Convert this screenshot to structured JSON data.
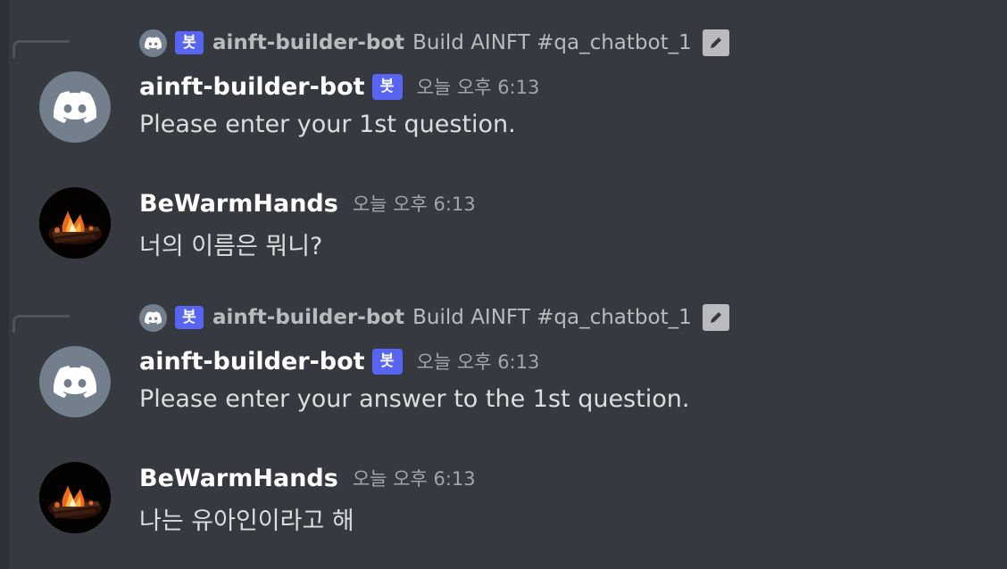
{
  "messages": [
    {
      "reply": {
        "bot_tag": "봇",
        "author": "ainft-builder-bot",
        "text": "Build AINFT #qa_chatbot_1"
      },
      "author": "ainft-builder-bot",
      "bot_tag": "봇",
      "timestamp": "오늘 오후 6:13",
      "content": "Please enter your 1st question."
    },
    {
      "author": "BeWarmHands",
      "timestamp": "오늘 오후 6:13",
      "content": "너의 이름은 뭐니?"
    },
    {
      "reply": {
        "bot_tag": "봇",
        "author": "ainft-builder-bot",
        "text": "Build AINFT #qa_chatbot_1"
      },
      "author": "ainft-builder-bot",
      "bot_tag": "봇",
      "timestamp": "오늘 오후 6:13",
      "content": "Please enter your answer to the 1st question."
    },
    {
      "author": "BeWarmHands",
      "timestamp": "오늘 오후 6:13",
      "content": "나는 유아인이라고 해"
    }
  ],
  "colors": {
    "background": "#36393f",
    "bot_tag": "#5865f2",
    "bot_avatar": "#747f8d",
    "username": "#ffffff",
    "message_text": "#dcddde",
    "timestamp": "#a3a6aa"
  },
  "icons": {
    "bot_avatar": "discord-logo-icon",
    "edit": "pencil-icon",
    "user_avatar": "campfire-avatar"
  }
}
